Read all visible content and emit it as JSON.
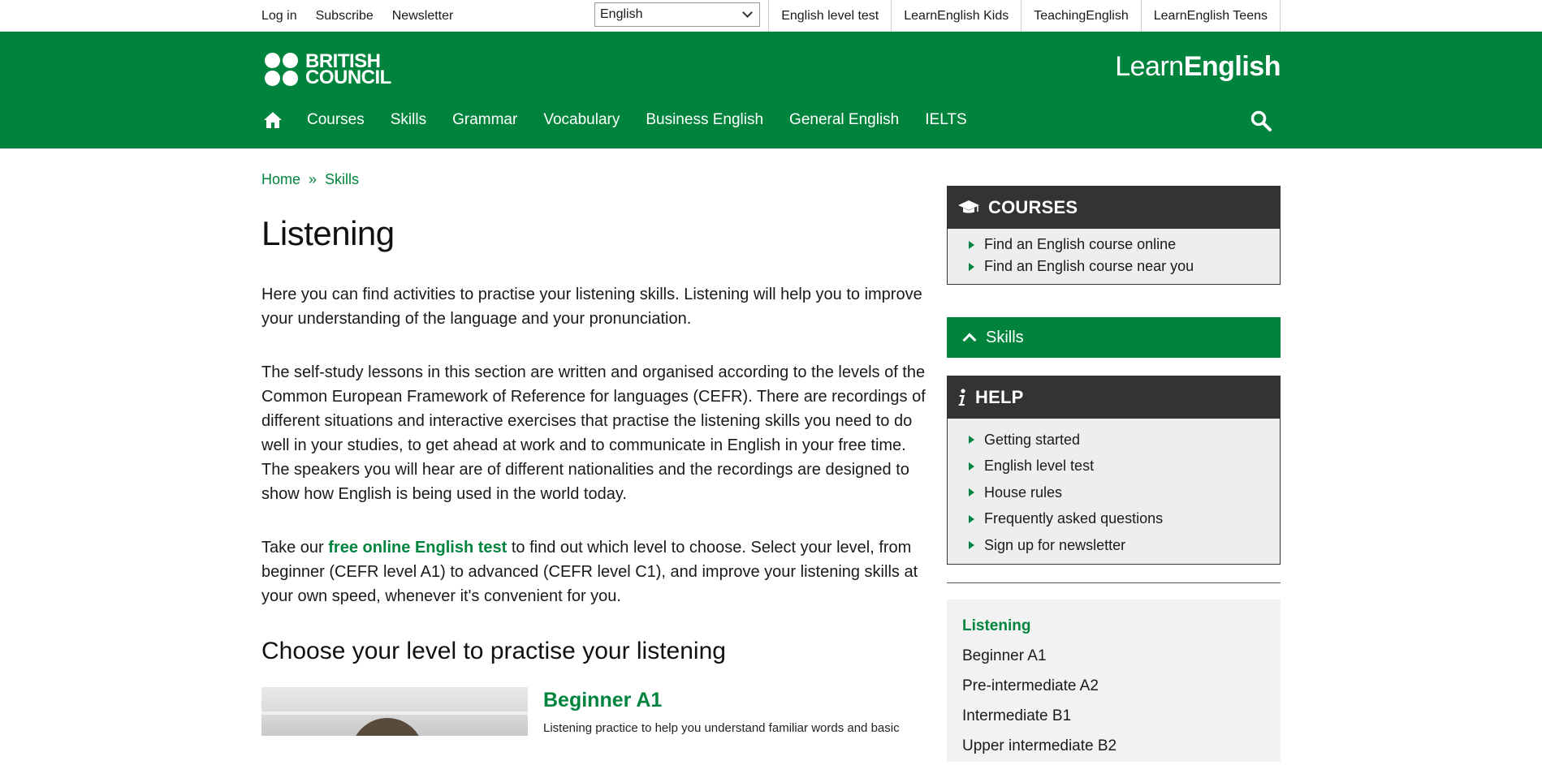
{
  "topbar": {
    "links": [
      "Log in",
      "Subscribe",
      "Newsletter"
    ],
    "language": "English",
    "sites": [
      "English level test",
      "LearnEnglish Kids",
      "TeachingEnglish",
      "LearnEnglish Teens"
    ]
  },
  "header": {
    "brand_line1": "BRITISH",
    "brand_line2": "COUNCIL",
    "site_learn": "Learn",
    "site_english": "English",
    "nav": [
      "Courses",
      "Skills",
      "Grammar",
      "Vocabulary",
      "Business English",
      "General English",
      "IELTS"
    ]
  },
  "breadcrumb": [
    "Home",
    "Skills"
  ],
  "page": {
    "title": "Listening",
    "para1": "Here you can find activities to practise your listening skills. Listening will help you to improve your understanding of the language and your pronunciation.",
    "para2": "The self-study lessons in this section are written and organised according to the levels of the Common European Framework of Reference for languages (CEFR). There are recordings of different situations and interactive exercises that practise the listening skills you need to do well in your studies, to get ahead at work and to communicate in English in your free time. The speakers you will hear are of different nationalities and the recordings are designed to show how English is being used in the world today.",
    "para3_pre": "Take our ",
    "para3_link": "free online English test",
    "para3_post": " to find out which level to choose. Select your level, from beginner (CEFR level A1) to advanced (CEFR level C1), and improve your listening skills at your own speed, whenever it's convenient for you.",
    "section_title": "Choose your level to practise your listening",
    "level_card": {
      "title": "Beginner A1",
      "desc": "Listening practice to help you understand familiar words and basic"
    }
  },
  "sidebar": {
    "courses_title": "COURSES",
    "courses_items": [
      "Find an English course online",
      "Find an English course near you"
    ],
    "skills_label": "Skills",
    "help_title": "HELP",
    "help_items": [
      "Getting started",
      "English level test",
      "House rules",
      "Frequently asked questions",
      "Sign up for newsletter"
    ],
    "levels_title": "Listening",
    "levels": [
      "Beginner A1",
      "Pre-intermediate A2",
      "Intermediate B1",
      "Upper intermediate B2"
    ]
  },
  "colors": {
    "brand_green": "#00843d",
    "dark_box": "#333333",
    "box_bg": "#ecefee"
  }
}
